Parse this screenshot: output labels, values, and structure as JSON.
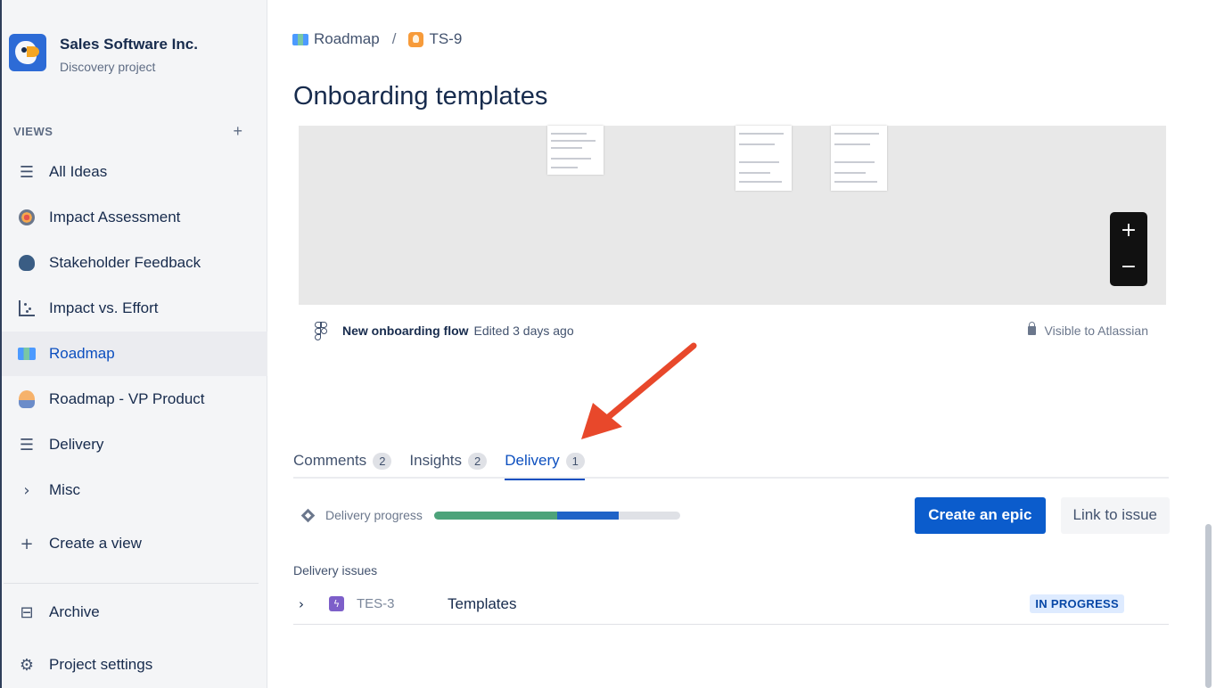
{
  "sidebar": {
    "project_name": "Sales Software Inc.",
    "project_type": "Discovery project",
    "views_label": "VIEWS",
    "views_add": "+",
    "items": [
      {
        "label": "All Ideas",
        "icon": "list-icon"
      },
      {
        "label": "Impact Assessment",
        "icon": "target-icon"
      },
      {
        "label": "Stakeholder Feedback",
        "icon": "speaker-head-icon"
      },
      {
        "label": "Impact vs. Effort",
        "icon": "scatter-chart-icon"
      },
      {
        "label": "Roadmap",
        "icon": "map-icon",
        "active": true
      },
      {
        "label": "Roadmap - VP Product",
        "icon": "person-icon"
      },
      {
        "label": "Delivery",
        "icon": "list-icon"
      },
      {
        "label": "Misc",
        "icon": "chevron-right-icon"
      }
    ],
    "create_view": "Create a view",
    "archive": "Archive",
    "project_settings": "Project settings"
  },
  "breadcrumb": {
    "parent": "Roadmap",
    "separator": "/",
    "current": "TS-9"
  },
  "page_title": "Onboarding templates",
  "preview": {
    "zoom_in": "+",
    "zoom_out": "−"
  },
  "file": {
    "name": "New onboarding flow",
    "edited": "Edited 3 days ago",
    "visibility": "Visible to Atlassian"
  },
  "tabs": [
    {
      "label": "Comments",
      "count": "2"
    },
    {
      "label": "Insights",
      "count": "2"
    },
    {
      "label": "Delivery",
      "count": "1",
      "active": true
    }
  ],
  "delivery": {
    "progress_label": "Delivery progress",
    "progress_done": 0.5,
    "progress_in_progress": 0.25,
    "create_epic": "Create an epic",
    "link_issue": "Link to issue",
    "issues_label": "Delivery issues",
    "issues": [
      {
        "key": "TES-3",
        "summary": "Templates",
        "status": "IN PROGRESS"
      }
    ]
  },
  "colors": {
    "accent": "#0b5ccc",
    "progress_done": "#4da37a",
    "progress_in_progress": "#1f63c7",
    "annotation_arrow": "#e8482b"
  }
}
